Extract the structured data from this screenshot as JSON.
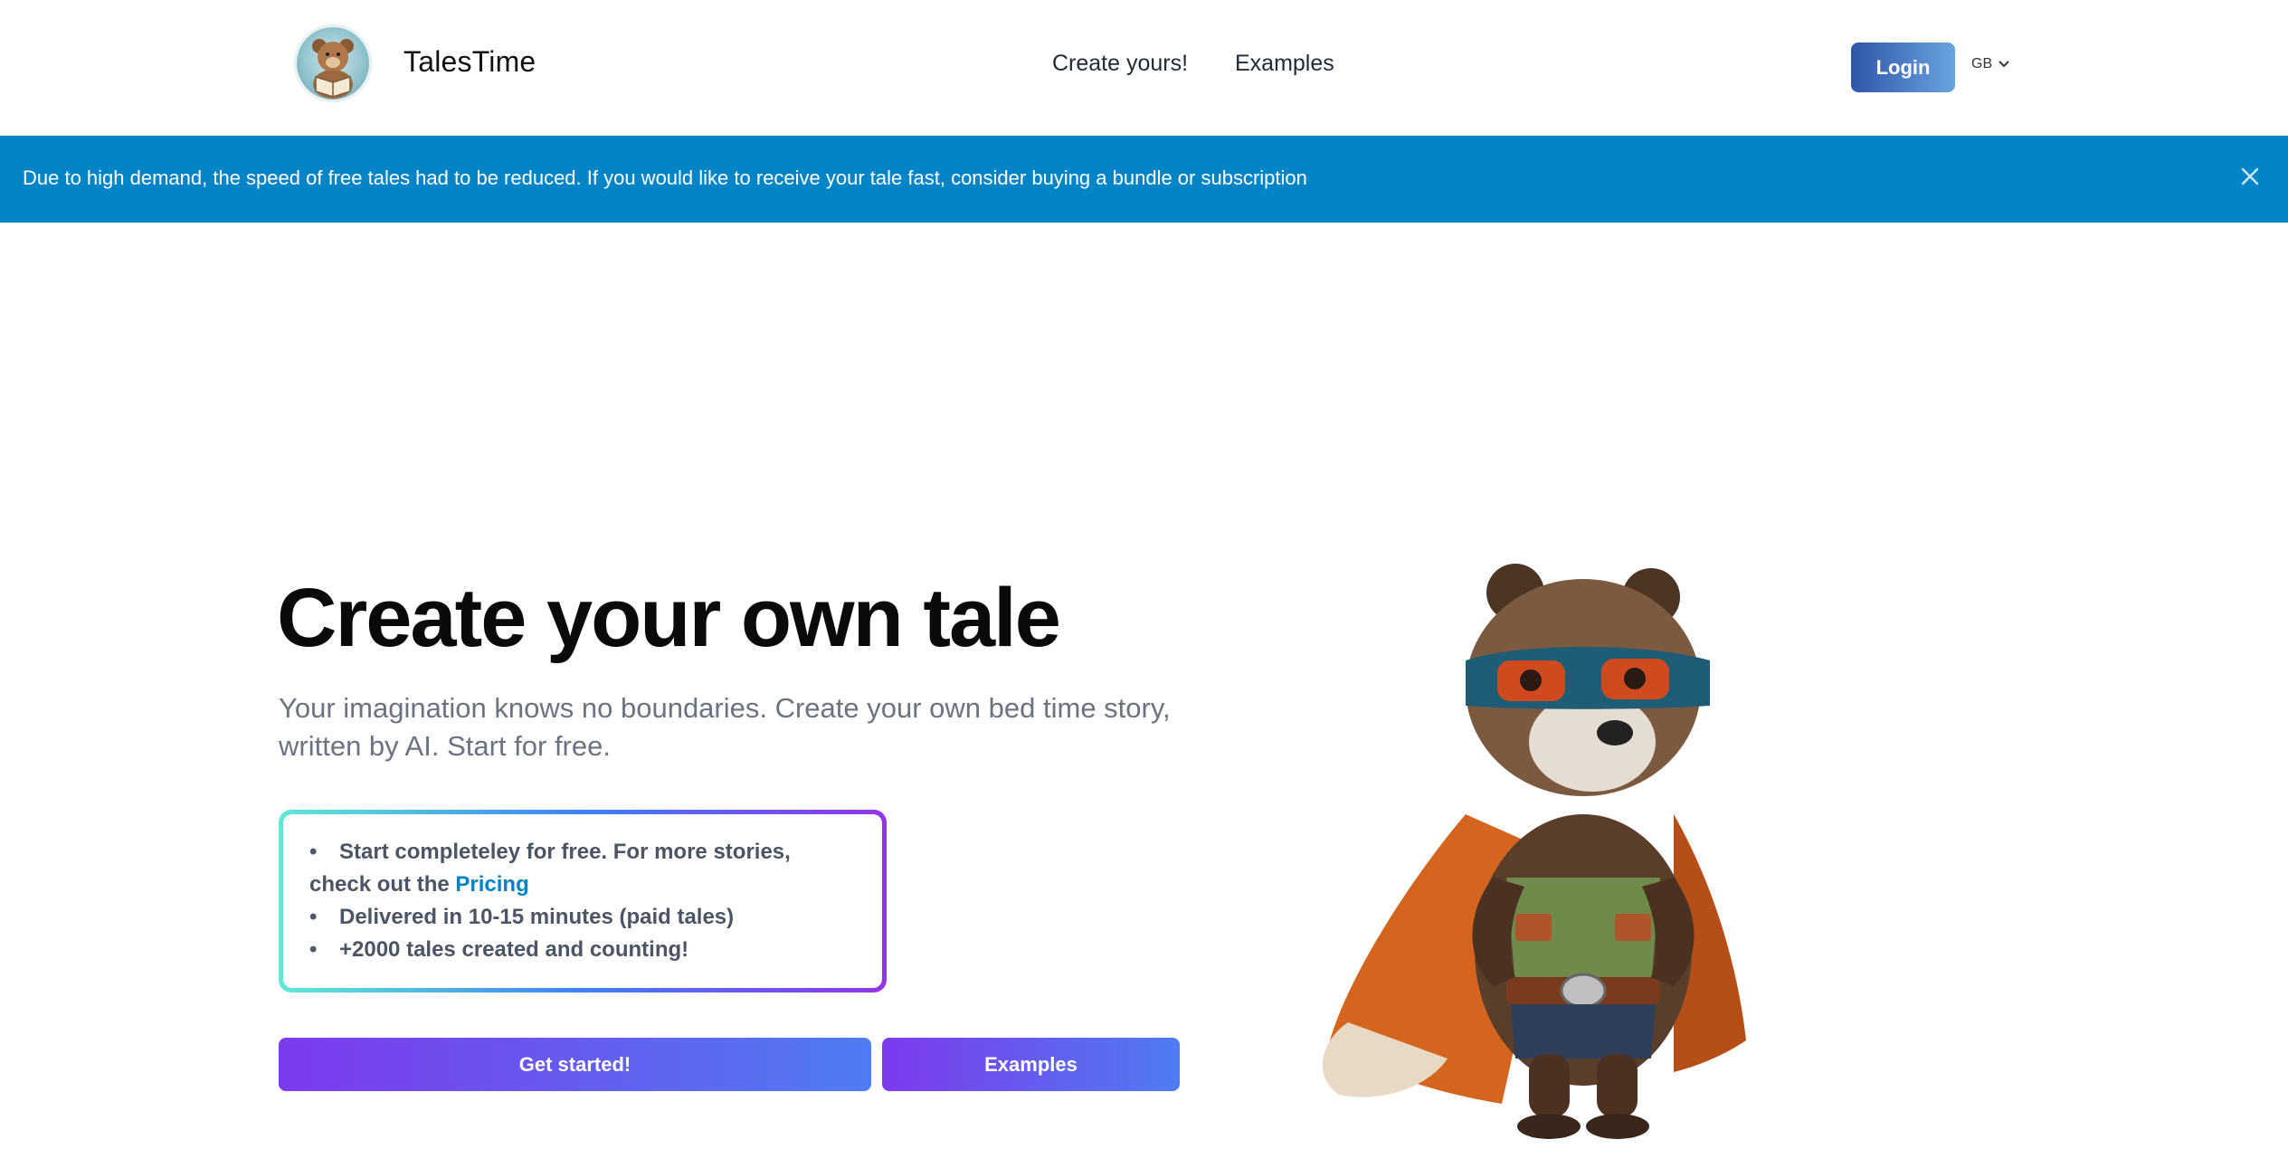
{
  "header": {
    "brand": "TalesTime",
    "nav": [
      {
        "label": "Create yours!"
      },
      {
        "label": "Examples"
      }
    ],
    "login_label": "Login",
    "language": "GB"
  },
  "banner": {
    "text": "Due to high demand, the speed of free tales had to be reduced. If you would like to receive your tale fast, consider buying a bundle or subscription"
  },
  "hero": {
    "title": "Create your own tale",
    "subtitle": "Your imagination knows no boundaries. Create your own bed time story, written by AI. Start for free.",
    "features": {
      "item1_text": "Start completeley for free. For more stories, check out the ",
      "item1_link": "Pricing",
      "item2": "Delivered in 10-15 minutes (paid tales)",
      "item3": "+2000 tales created and counting!"
    },
    "get_started_label": "Get started!",
    "examples_label": "Examples"
  },
  "colors": {
    "banner": "#0284c7",
    "cta_start": "#7c3aed",
    "cta_end": "#4f7cf3",
    "login_start": "#2f56a8",
    "login_end": "#6aa3df"
  }
}
